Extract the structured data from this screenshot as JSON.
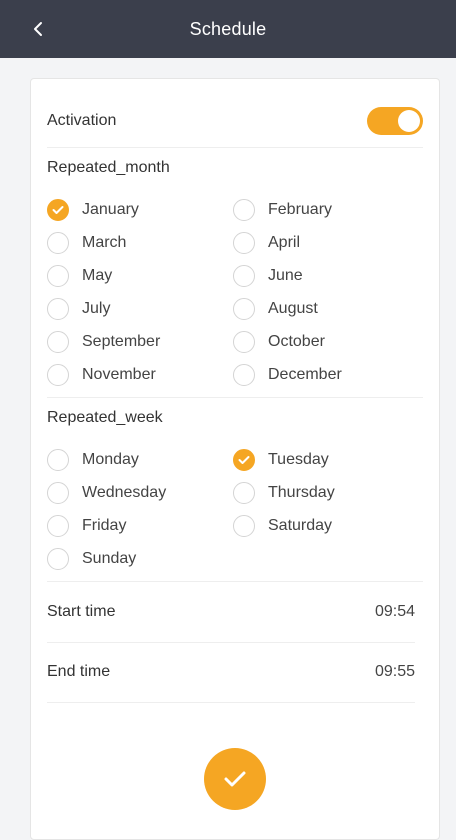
{
  "header": {
    "title": "Schedule",
    "back_icon": "chevron-left-icon"
  },
  "activation": {
    "label": "Activation",
    "enabled": true
  },
  "repeated_month": {
    "title": "Repeated_month",
    "options": [
      {
        "label": "January",
        "checked": true
      },
      {
        "label": "February",
        "checked": false
      },
      {
        "label": "March",
        "checked": false
      },
      {
        "label": "April",
        "checked": false
      },
      {
        "label": "May",
        "checked": false
      },
      {
        "label": "June",
        "checked": false
      },
      {
        "label": "July",
        "checked": false
      },
      {
        "label": "August",
        "checked": false
      },
      {
        "label": "September",
        "checked": false
      },
      {
        "label": "October",
        "checked": false
      },
      {
        "label": "November",
        "checked": false
      },
      {
        "label": "December",
        "checked": false
      }
    ]
  },
  "repeated_week": {
    "title": "Repeated_week",
    "options": [
      {
        "label": "Monday",
        "checked": false
      },
      {
        "label": "Tuesday",
        "checked": true
      },
      {
        "label": "Wednesday",
        "checked": false
      },
      {
        "label": "Thursday",
        "checked": false
      },
      {
        "label": "Friday",
        "checked": false
      },
      {
        "label": "Saturday",
        "checked": false
      },
      {
        "label": "Sunday",
        "checked": false
      }
    ]
  },
  "start_time": {
    "label": "Start time",
    "value": "09:54"
  },
  "end_time": {
    "label": "End time",
    "value": "09:55"
  },
  "colors": {
    "accent": "#f5a623",
    "header_bg": "#3b3f4c"
  }
}
